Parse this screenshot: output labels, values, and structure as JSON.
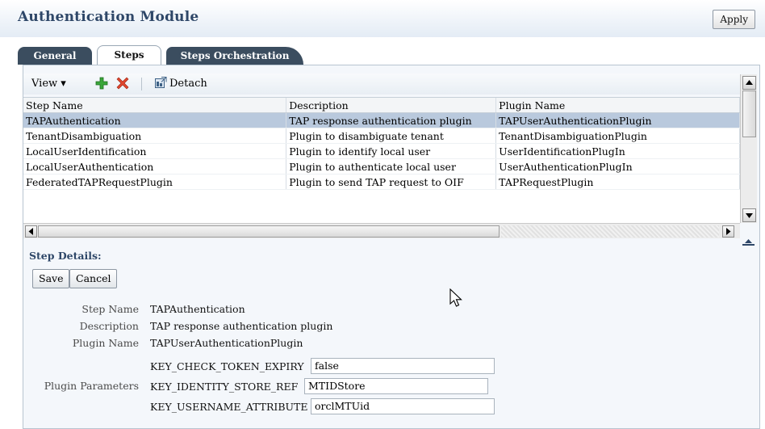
{
  "header": {
    "title": "Authentication Module",
    "apply_label": "Apply"
  },
  "tabs": [
    {
      "label": "General",
      "active": false
    },
    {
      "label": "Steps",
      "active": true
    },
    {
      "label": "Steps Orchestration",
      "active": false
    }
  ],
  "toolbar": {
    "view_label": "View",
    "detach_label": "Detach"
  },
  "table": {
    "columns": [
      "Step Name",
      "Description",
      "Plugin Name"
    ],
    "rows": [
      [
        "TAPAuthentication",
        "TAP response authentication plugin",
        "TAPUserAuthenticationPlugin"
      ],
      [
        "TenantDisambiguation",
        "Plugin to disambiguate tenant",
        "TenantDisambiguationPlugin"
      ],
      [
        "LocalUserIdentification",
        "Plugin to identify local user",
        "UserIdentificationPlugIn"
      ],
      [
        "LocalUserAuthentication",
        "Plugin to authenticate local user",
        "UserAuthenticationPlugIn"
      ],
      [
        "FederatedTAPRequestPlugin",
        "Plugin to send TAP request to OIF",
        "TAPRequestPlugin"
      ]
    ],
    "selected_row": 0
  },
  "details": {
    "title": "Step Details:",
    "save_label": "Save",
    "cancel_label": "Cancel",
    "step_name_label": "Step Name",
    "step_name_value": "TAPAuthentication",
    "description_label": "Description",
    "description_value": "TAP response authentication plugin",
    "plugin_name_label": "Plugin Name",
    "plugin_name_value": "TAPUserAuthenticationPlugin",
    "plugin_params_label": "Plugin Parameters",
    "params": [
      {
        "key": "KEY_CHECK_TOKEN_EXPIRY",
        "value": "false"
      },
      {
        "key": "KEY_IDENTITY_STORE_REF",
        "value": "MTIDStore"
      },
      {
        "key": "KEY_USERNAME_ATTRIBUTE",
        "value": "orclMTUid"
      }
    ]
  },
  "colors": {
    "title": "#2e4768",
    "selected_row": "#b9c9dd",
    "tab_dark": "#3b4d5f"
  }
}
